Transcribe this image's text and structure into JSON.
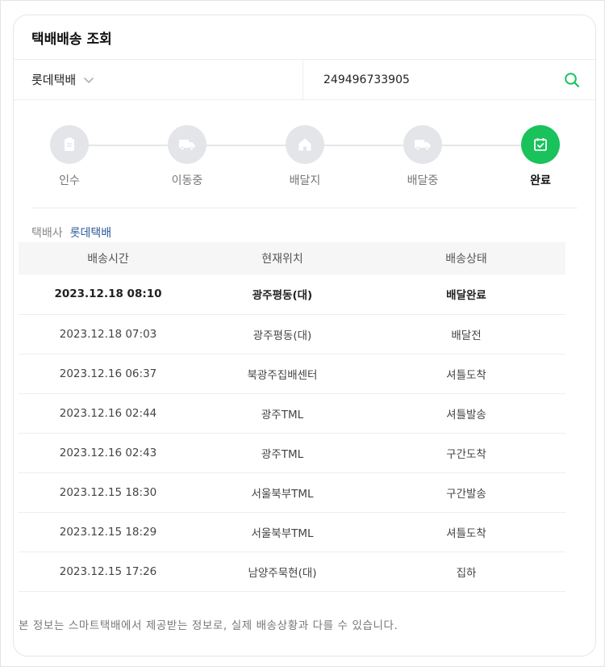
{
  "card": {
    "title": "택배배송 조회"
  },
  "search": {
    "carrier": "롯데택배",
    "tracking_number": "249496733905",
    "icon": "search-icon",
    "accent": "#19c25b"
  },
  "steps": [
    {
      "label": "인수",
      "icon": "clipboard-icon",
      "active": false
    },
    {
      "label": "이동중",
      "icon": "truck-icon",
      "active": false
    },
    {
      "label": "배달지",
      "icon": "home-icon",
      "active": false
    },
    {
      "label": "배달중",
      "icon": "delivery-truck-icon",
      "active": false
    },
    {
      "label": "완료",
      "icon": "calendar-check-icon",
      "active": true
    }
  ],
  "carrier_info": {
    "key": "택배사",
    "value": "롯데택배"
  },
  "table": {
    "headers": [
      "배송시간",
      "현재위치",
      "배송상태"
    ],
    "rows": [
      {
        "time": "2023.12.18 08:10",
        "location": "광주평동(대)",
        "status": "배달완료",
        "latest": true
      },
      {
        "time": "2023.12.18 07:03",
        "location": "광주평동(대)",
        "status": "배달전"
      },
      {
        "time": "2023.12.16 06:37",
        "location": "북광주집배센터",
        "status": "셔틀도착"
      },
      {
        "time": "2023.12.16 02:44",
        "location": "광주TML",
        "status": "셔틀발송"
      },
      {
        "time": "2023.12.16 02:43",
        "location": "광주TML",
        "status": "구간도착"
      },
      {
        "time": "2023.12.15 18:30",
        "location": "서울북부TML",
        "status": "구간발송"
      },
      {
        "time": "2023.12.15 18:29",
        "location": "서울북부TML",
        "status": "셔틀도착"
      },
      {
        "time": "2023.12.15 17:26",
        "location": "남양주묵현(대)",
        "status": "집하"
      }
    ]
  },
  "footnote": "본 정보는 스마트택배에서 제공받는 정보로, 실제 배송상황과 다를 수 있습니다."
}
